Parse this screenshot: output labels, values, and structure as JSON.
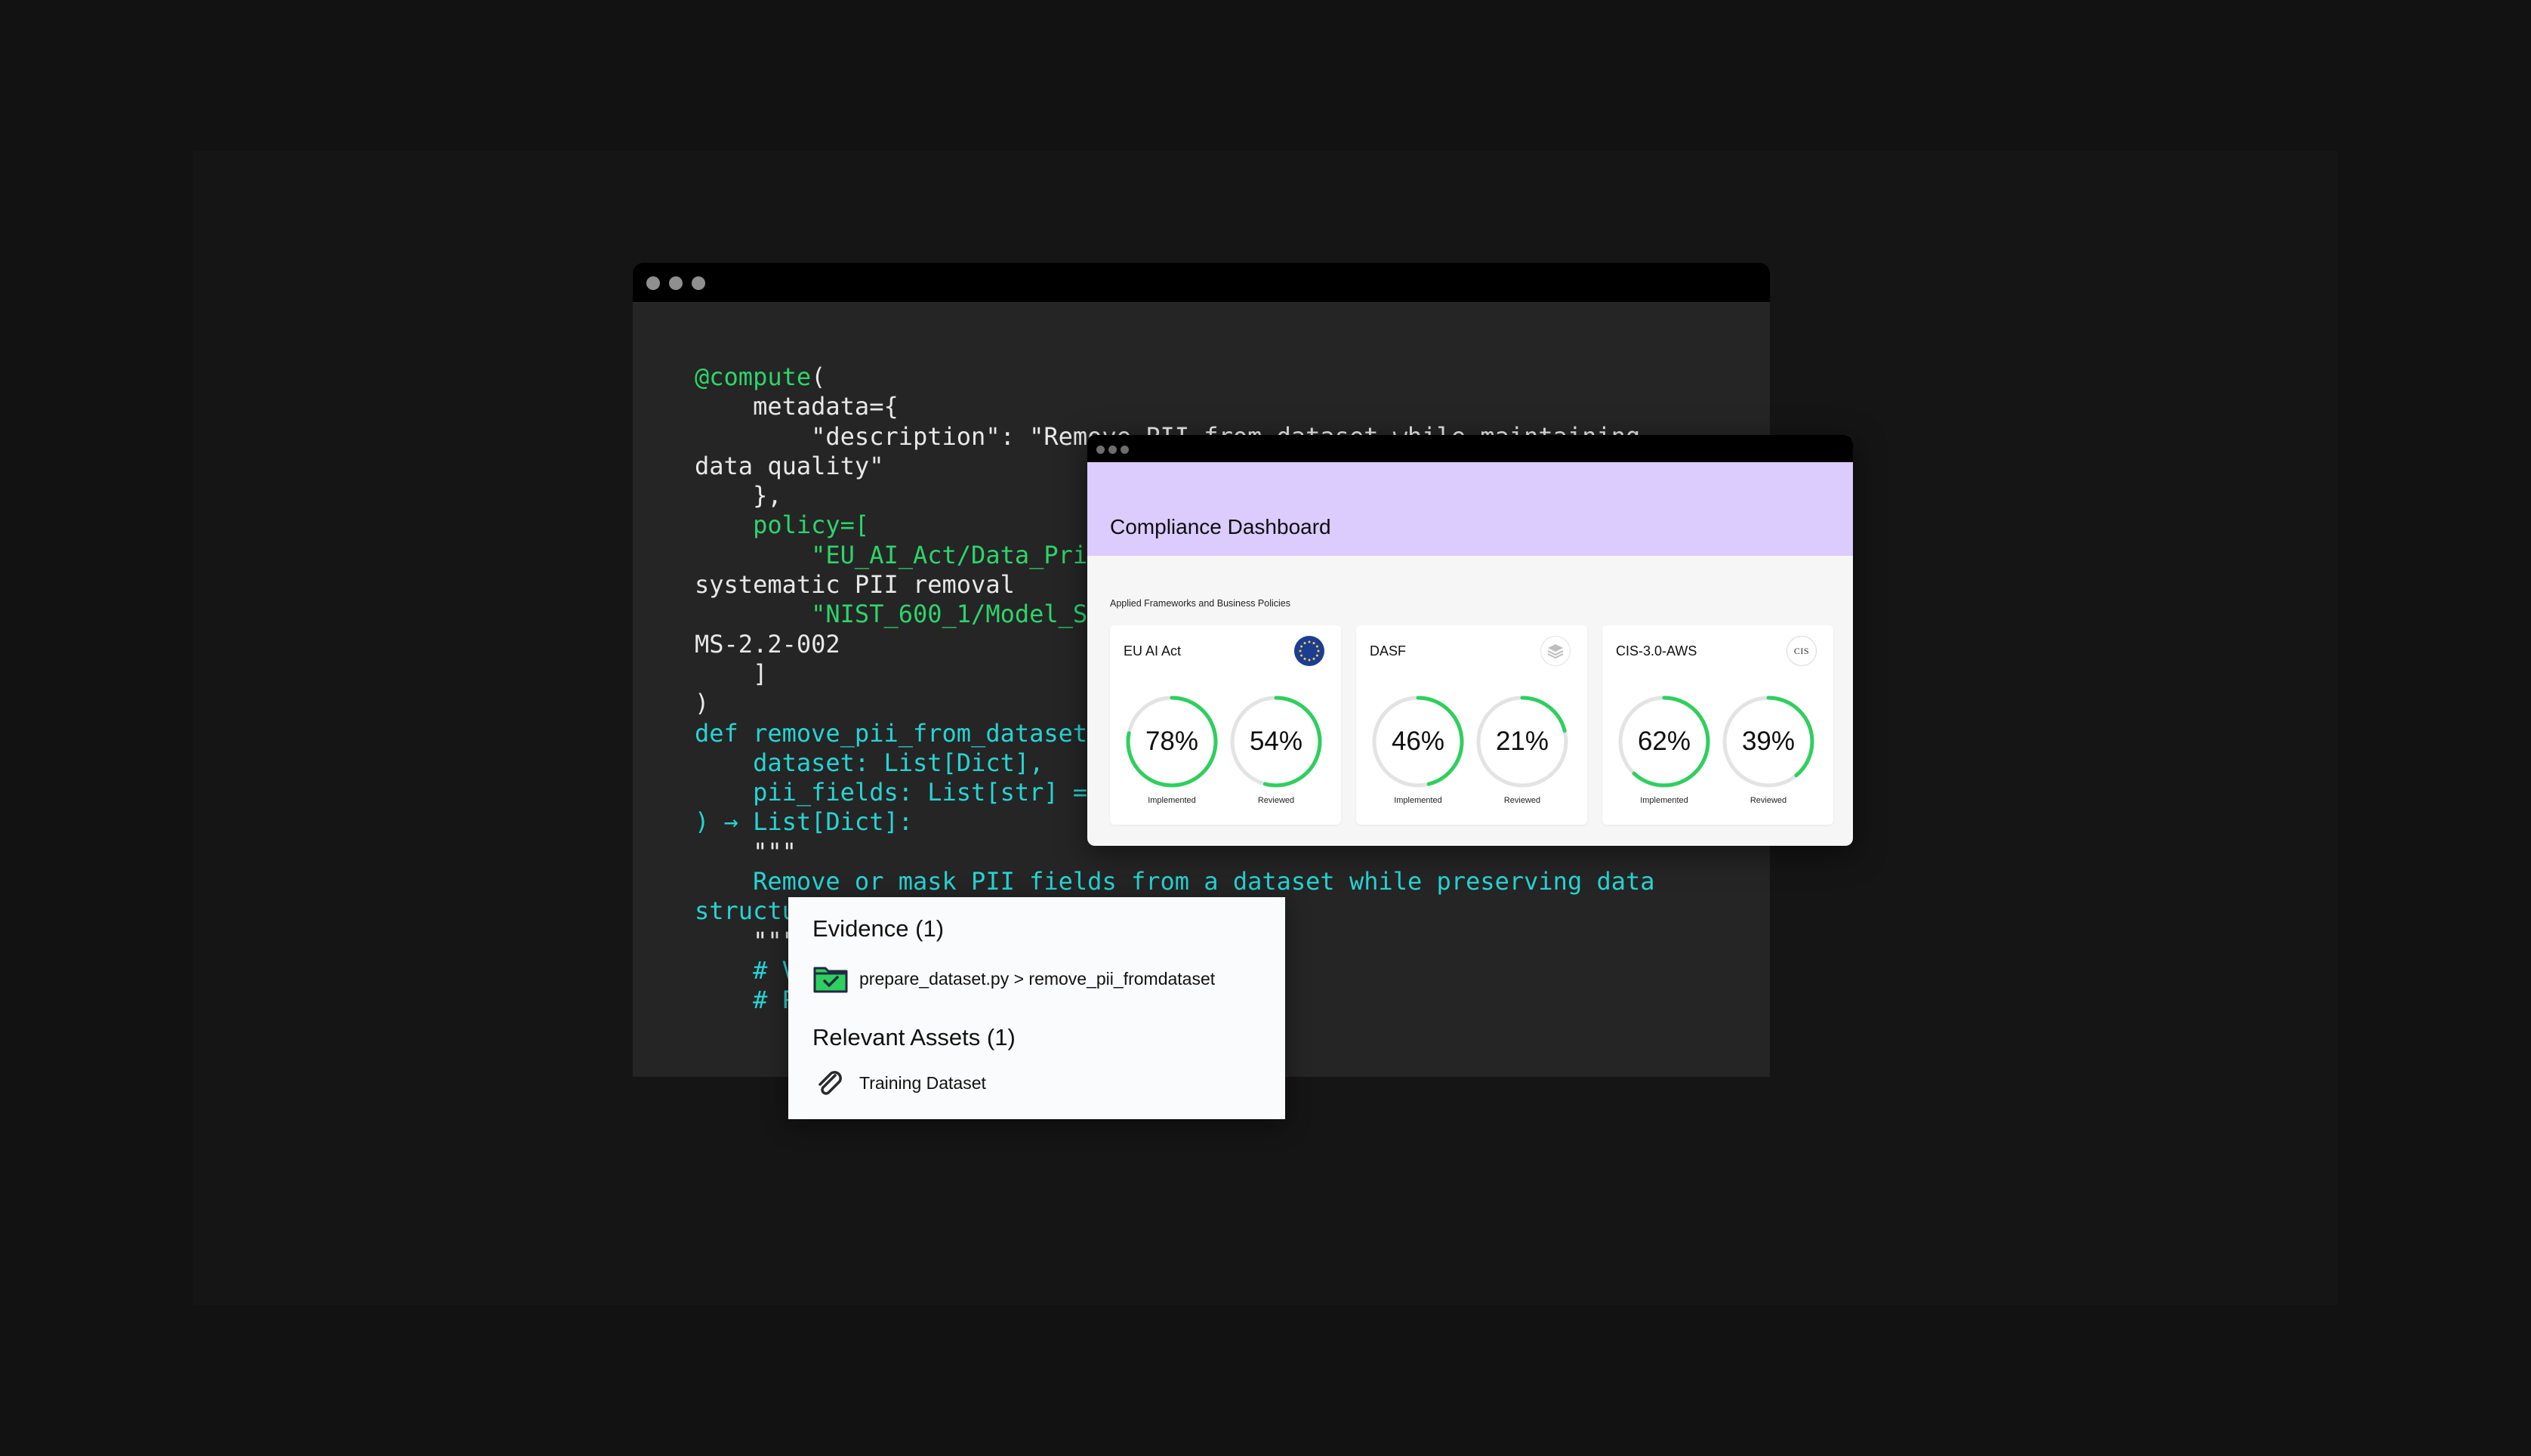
{
  "code_window": {
    "lines": [
      [
        {
          "t": "@compute",
          "c": "g"
        },
        {
          "t": "(",
          "c": "w"
        }
      ],
      [
        {
          "t": "    metadata={",
          "c": "w"
        }
      ],
      [
        {
          "t": "        \"description\": \"Remove PII from dataset while maintaining",
          "c": "w"
        }
      ],
      [
        {
          "t": "data quality\"",
          "c": "w"
        }
      ],
      [
        {
          "t": "    },",
          "c": "w"
        }
      ],
      [
        {
          "t": "    policy=[",
          "c": "g"
        }
      ],
      [
        {
          "t": "        \"EU_AI_Act/Data_Privacy",
          "c": "g"
        }
      ],
      [
        {
          "t": "systematic PII removal",
          "c": "w"
        }
      ],
      [
        {
          "t": "        \"NIST_600_1/Model_S",
          "c": "g"
        }
      ],
      [
        {
          "t": "MS-2.2-002",
          "c": "w"
        }
      ],
      [
        {
          "t": "    ]",
          "c": "w"
        }
      ],
      [
        {
          "t": ")",
          "c": "w"
        }
      ],
      [
        {
          "t": "def remove_pii_from_dataset(",
          "c": "c"
        }
      ],
      [
        {
          "t": "    dataset: List[Dict],",
          "c": "c"
        }
      ],
      [
        {
          "t": "    pii_fields: List[str] = None",
          "c": "c"
        }
      ],
      [
        {
          "t": ") → List[Dict]:",
          "c": "c"
        }
      ],
      [
        {
          "t": "    \"\"\"",
          "c": "w"
        }
      ],
      [
        {
          "t": "    Remove or mask PII fields from a dataset while preserving data",
          "c": "c"
        }
      ],
      [
        {
          "t": "structure",
          "c": "c"
        }
      ],
      [
        {
          "t": "    \"\"\"",
          "c": "w"
        }
      ],
      [
        {
          "t": "    # Validate",
          "c": "c"
        }
      ],
      [
        {
          "t": "    # Process",
          "c": "c"
        }
      ]
    ]
  },
  "dashboard": {
    "title": "Compliance Dashboard",
    "subtitle": "Applied Frameworks and Business Policies",
    "frameworks": [
      {
        "name": "EU AI Act",
        "badge": "eu-flag-icon",
        "badge_text": "",
        "implemented": 78,
        "reviewed": 54
      },
      {
        "name": "DASF",
        "badge": "layers-icon",
        "badge_text": "",
        "implemented": 46,
        "reviewed": 21
      },
      {
        "name": "CIS-3.0-AWS",
        "badge": "cis-logo-icon",
        "badge_text": "CIS",
        "implemented": 62,
        "reviewed": 39
      }
    ],
    "implemented_label": "Implemented",
    "reviewed_label": "Reviewed",
    "colors": {
      "header": "#dccbfd",
      "gauge_fill": "#2fcf5e",
      "gauge_track": "#e3e3e3"
    }
  },
  "evidence_panel": {
    "evidence_heading": "Evidence (1)",
    "evidence_item": "prepare_dataset.py > remove_pii_fromdataset",
    "assets_heading": "Relevant Assets (1)",
    "asset_item": "Training Dataset"
  }
}
